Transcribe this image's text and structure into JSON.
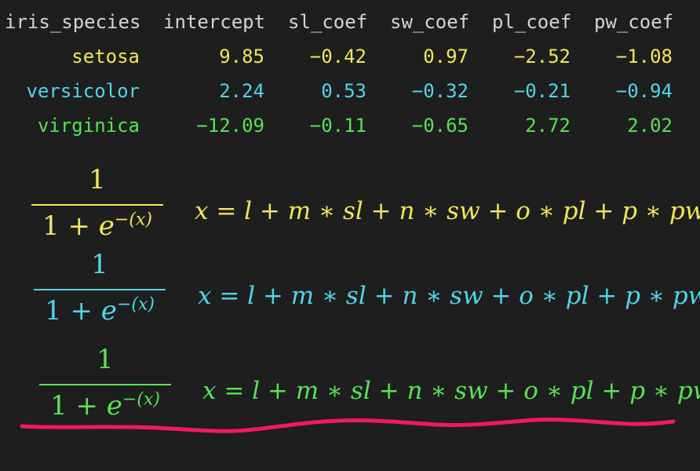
{
  "colors": {
    "background": "#1e1e1e",
    "header": "#d4d4d4",
    "setosa": "#f2e657",
    "versicolor": "#4fd6e8",
    "virginica": "#57e357",
    "underline": "#f2195f"
  },
  "table": {
    "headers": [
      "iris_species",
      "intercept",
      "sl_coef",
      "sw_coef",
      "pl_coef",
      "pw_coef"
    ],
    "rows": [
      {
        "species": "setosa",
        "values": [
          "9.85",
          "−0.42",
          "0.97",
          "−2.52",
          "−1.08"
        ]
      },
      {
        "species": "versicolor",
        "values": [
          "2.24",
          "0.53",
          "−0.32",
          "−0.21",
          "−0.94"
        ]
      },
      {
        "species": "virginica",
        "values": [
          "−12.09",
          "−0.11",
          "−0.65",
          "2.72",
          "2.02"
        ]
      }
    ]
  },
  "formulas": [
    {
      "numerator": "1",
      "denominator_base": "1 + ",
      "denominator_e": "e",
      "exponent": "−(x)",
      "equation": "x = l + m ∗ sl + n ∗ sw + o ∗ pl + p ∗ pw"
    },
    {
      "numerator": "1",
      "denominator_base": "1 + ",
      "denominator_e": "e",
      "exponent": "−(x)",
      "equation": "x = l + m ∗ sl + n ∗ sw + o ∗ pl + p ∗ pw"
    },
    {
      "numerator": "1",
      "denominator_base": "1 + ",
      "denominator_e": "e",
      "exponent": "−(x)",
      "equation": "x = l + m ∗ sl + n ∗ sw + o ∗ pl + p ∗ pw"
    }
  ]
}
